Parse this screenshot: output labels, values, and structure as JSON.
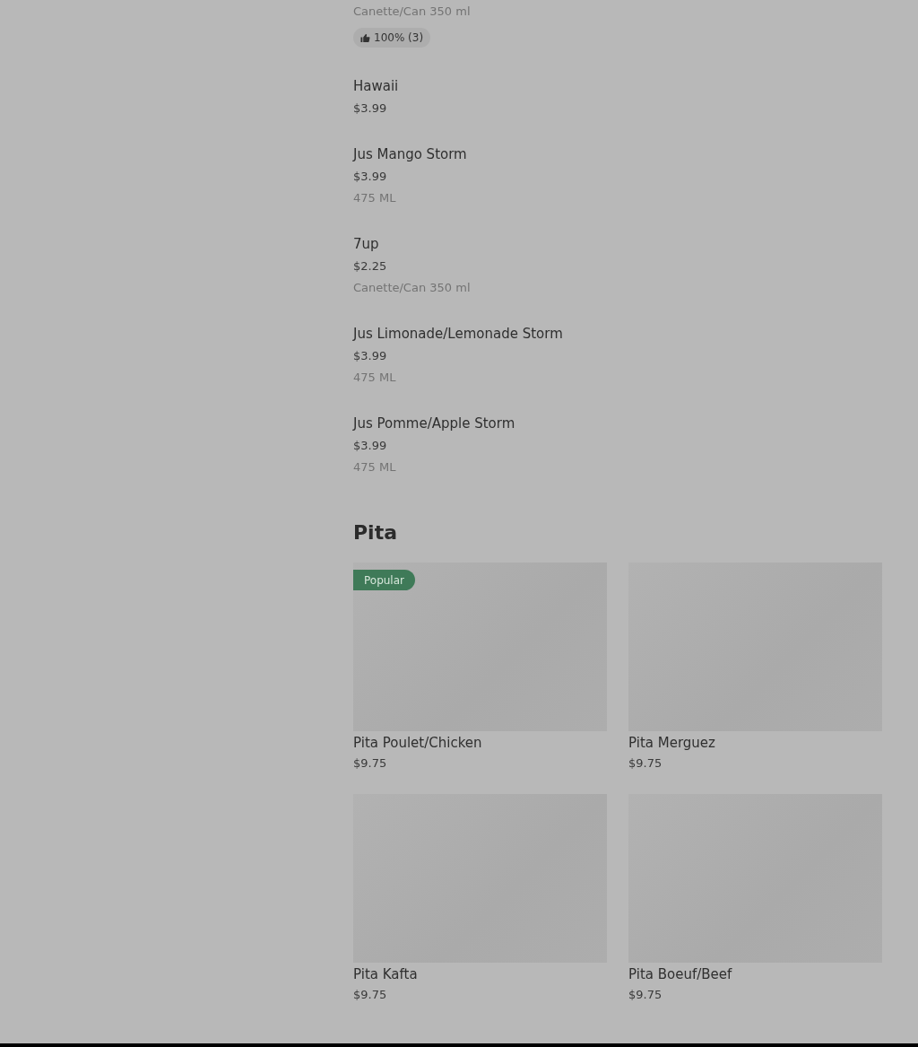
{
  "menu_items": [
    {
      "description": "Canette/Can 350 ml",
      "rating": "100% (3)"
    },
    {
      "name": "Hawaii",
      "price": "$3.99"
    },
    {
      "name": "Jus Mango Storm",
      "price": "$3.99",
      "description": "475 ML"
    },
    {
      "name": "7up",
      "price": "$2.25",
      "description": "Canette/Can 350 ml"
    },
    {
      "name": "Jus Limonade/Lemonade Storm",
      "price": "$3.99",
      "description": "475 ML"
    },
    {
      "name": "Jus Pomme/Apple Storm",
      "price": "$3.99",
      "description": "475 ML"
    }
  ],
  "section": {
    "title": "Pita",
    "cards": [
      {
        "name": "Pita Poulet/Chicken",
        "price": "$9.75",
        "badge": "Popular"
      },
      {
        "name": "Pita Merguez",
        "price": "$9.75"
      },
      {
        "name": "Pita Kafta",
        "price": "$9.75"
      },
      {
        "name": "Pita Boeuf/Beef",
        "price": "$9.75"
      }
    ]
  }
}
